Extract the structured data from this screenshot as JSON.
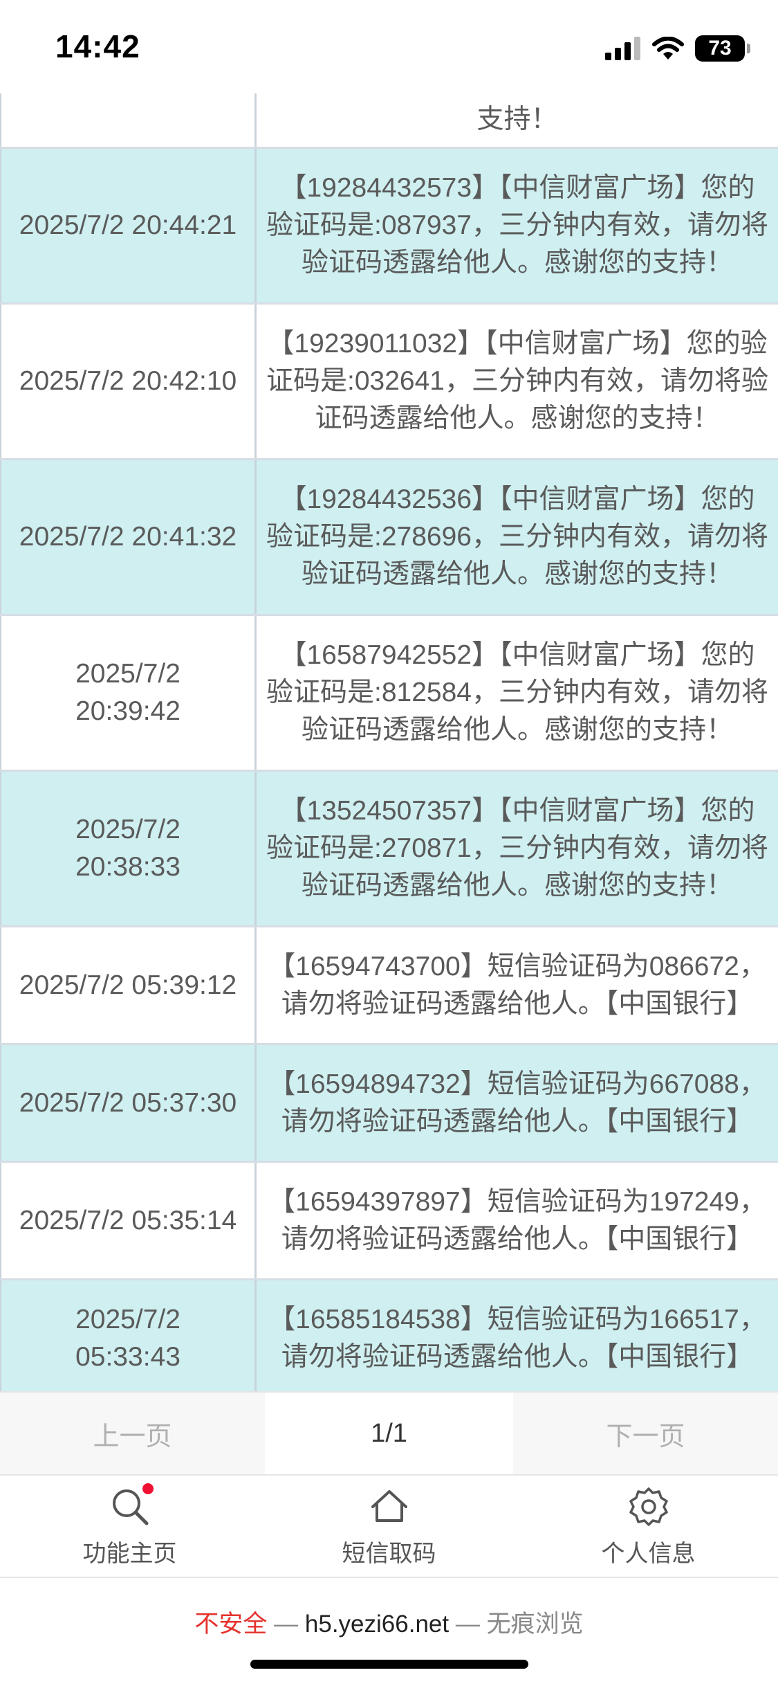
{
  "status_bar": {
    "time": "14:42",
    "battery": "73",
    "icons": [
      "cellular-signal-icon",
      "wifi-icon",
      "battery-icon"
    ]
  },
  "messages": [
    {
      "time": "",
      "text": "效，请勿将验证码透露给他人。感谢您的支持！"
    },
    {
      "time": "2025/7/2 20:44:21",
      "text": "【19284432573】【中信财富广场】您的验证码是:087937，三分钟内有效，请勿将验证码透露给他人。感谢您的支持！"
    },
    {
      "time": "2025/7/2 20:42:10",
      "text": "【19239011032】【中信财富广场】您的验证码是:032641，三分钟内有效，请勿将验证码透露给他人。感谢您的支持！"
    },
    {
      "time": "2025/7/2 20:41:32",
      "text": "【19284432536】【中信财富广场】您的验证码是:278696，三分钟内有效，请勿将验证码透露给他人。感谢您的支持！"
    },
    {
      "time": "2025/7/2 20:39:42",
      "text": "【16587942552】【中信财富广场】您的验证码是:812584，三分钟内有效，请勿将验证码透露给他人。感谢您的支持！"
    },
    {
      "time": "2025/7/2 20:38:33",
      "text": "【13524507357】【中信财富广场】您的验证码是:270871，三分钟内有效，请勿将验证码透露给他人。感谢您的支持！"
    },
    {
      "time": "2025/7/2 05:39:12",
      "text": "【16594743700】短信验证码为086672，请勿将验证码透露给他人。【中国银行】"
    },
    {
      "time": "2025/7/2 05:37:30",
      "text": "【16594894732】短信验证码为667088，请勿将验证码透露给他人。【中国银行】"
    },
    {
      "time": "2025/7/2 05:35:14",
      "text": "【16594397897】短信验证码为197249，请勿将验证码透露给他人。【中国银行】"
    },
    {
      "time": "2025/7/2 05:33:43",
      "text": "【16585184538】短信验证码为166517，请勿将验证码透露给他人。【中国银行】"
    }
  ],
  "pager": {
    "prev": "上一页",
    "info": "1/1",
    "next": "下一页"
  },
  "tabs": [
    {
      "label": "功能主页",
      "icon": "search-icon",
      "badge": true
    },
    {
      "label": "短信取码",
      "icon": "home-icon",
      "badge": false
    },
    {
      "label": "个人信息",
      "icon": "gear-icon",
      "badge": false
    }
  ],
  "browser": {
    "insecure_label": "不安全",
    "separator": " — ",
    "host": "h5.yezi66.net",
    "mode_separator": " — ",
    "mode": "无痕浏览"
  },
  "colors": {
    "row_alt": "#cfeff0",
    "badge": "#ee1133",
    "insecure": "#e5322d"
  }
}
